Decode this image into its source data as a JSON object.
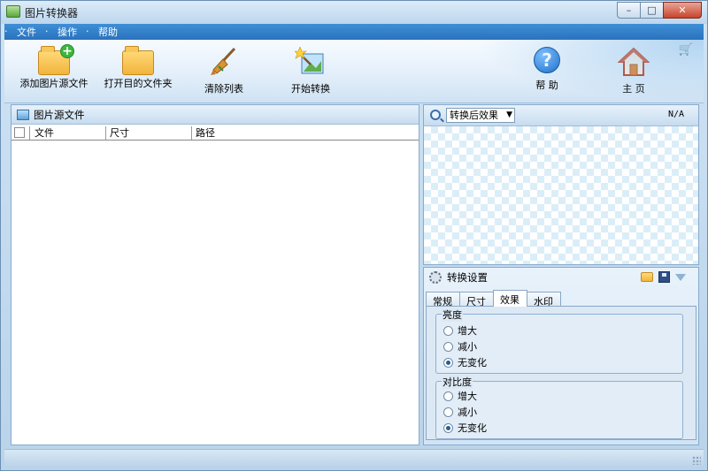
{
  "window": {
    "title": "图片转换器"
  },
  "menu": {
    "items": [
      "文件",
      "操作",
      "帮助"
    ]
  },
  "toolbar": {
    "add_label": "添加图片源文件",
    "open_label": "打开目的文件夹",
    "clear_label": "清除列表",
    "start_label": "开始转换",
    "help_label": "帮 助",
    "home_label": "主 页"
  },
  "source_panel": {
    "title": "图片源文件",
    "columns": [
      "文件",
      "尺寸",
      "路径"
    ]
  },
  "preview": {
    "dropdown_value": "转换后效果",
    "status": "N/A"
  },
  "settings": {
    "title": "转换设置",
    "tabs": [
      "常规",
      "尺寸",
      "效果",
      "水印"
    ],
    "active_tab": "效果",
    "brightness": {
      "title": "亮度",
      "options": [
        "增大",
        "减小",
        "无变化"
      ],
      "selected": "无变化"
    },
    "contrast": {
      "title": "对比度",
      "options": [
        "增大",
        "减小",
        "无变化"
      ],
      "selected": "无变化"
    }
  }
}
